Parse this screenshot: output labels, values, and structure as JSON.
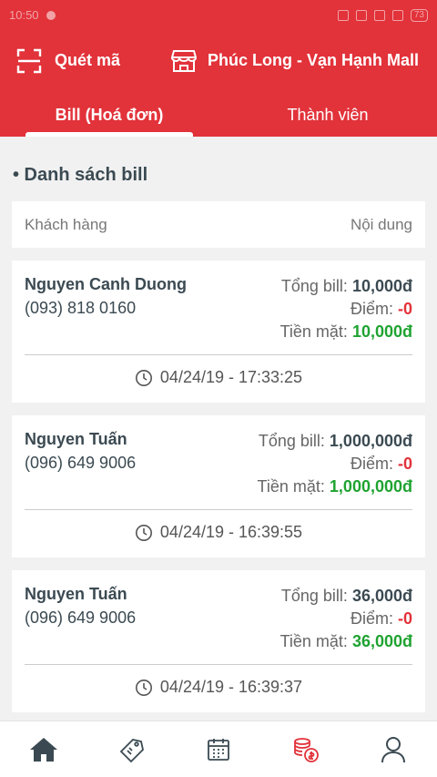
{
  "status_bar": {
    "time": "10:50",
    "battery": "73"
  },
  "header": {
    "scan_label": "Quét mã",
    "store_name": "Phúc Long - Vạn Hạnh Mall",
    "accent_color": "#e2323a"
  },
  "tabs": [
    {
      "label": "Bill (Hoá đơn)",
      "active": true
    },
    {
      "label": "Thành viên",
      "active": false
    }
  ],
  "section": {
    "title": "• Danh sách bill"
  },
  "columns": {
    "left": "Khách hàng",
    "right": "Nội dung"
  },
  "labels": {
    "total": "Tổng bill:",
    "points": "Điểm:",
    "cash": "Tiền mặt:"
  },
  "bills": [
    {
      "name": "Nguyen Canh Duong",
      "phone": "(093) 818 0160",
      "total": "10,000đ",
      "points": "-0",
      "cash": "10,000đ",
      "time": "04/24/19 - 17:33:25"
    },
    {
      "name": "Nguyen Tuấn",
      "phone": "(096) 649 9006",
      "total": "1,000,000đ",
      "points": "-0",
      "cash": "1,000,000đ",
      "time": "04/24/19 - 16:39:55"
    },
    {
      "name": "Nguyen Tuấn",
      "phone": "(096) 649 9006",
      "total": "36,000đ",
      "points": "-0",
      "cash": "36,000đ",
      "time": "04/24/19 - 16:39:37"
    }
  ],
  "nav": [
    {
      "icon": "home-icon",
      "active": true
    },
    {
      "icon": "coupon-icon",
      "active": false
    },
    {
      "icon": "calendar-icon",
      "active": false
    },
    {
      "icon": "coins-icon",
      "active": false
    },
    {
      "icon": "user-icon",
      "active": false
    }
  ]
}
